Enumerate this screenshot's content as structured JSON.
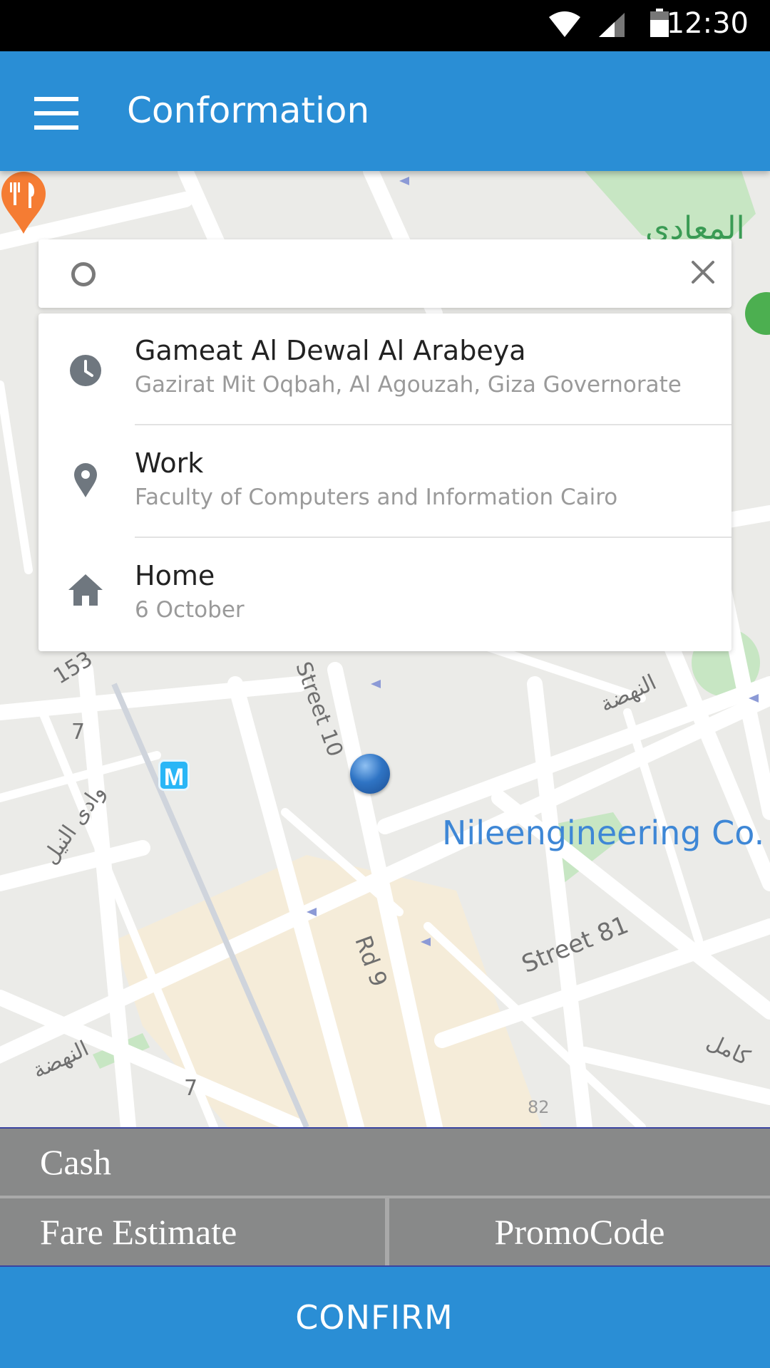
{
  "status_bar": {
    "time": "12:30",
    "icons": [
      "wifi-icon",
      "signal-icon",
      "battery-icon"
    ]
  },
  "app_bar": {
    "title": "Conformation",
    "menu_icon": "menu-icon"
  },
  "search": {
    "value": "",
    "placeholder": "",
    "origin_icon": "circle-outline-icon",
    "clear_icon": "close-icon"
  },
  "suggestions": [
    {
      "icon": "clock-icon",
      "title": "Gameat Al Dewal Al Arabeya",
      "subtitle": "Gazirat Mit Oqbah, Al Agouzah, Giza Governorate"
    },
    {
      "icon": "location-pin-icon",
      "title": "Work",
      "subtitle": "Faculty of Computers and Information Cairo"
    },
    {
      "icon": "home-icon",
      "title": "Home",
      "subtitle": "6 October"
    }
  ],
  "map": {
    "company_label": "Nileengineering Co.",
    "arabic_area": "المعادى",
    "metro_letter": "M",
    "street_labels": [
      "Street 81",
      "Rd 9",
      "Street 10",
      "153",
      "النهضة",
      "وادى النيل",
      "النهضة",
      "كامل",
      "7",
      "7",
      "82"
    ]
  },
  "payment": {
    "method": "Cash",
    "fare_label": "Fare Estimate",
    "promo_label": "PromoCode"
  },
  "confirm": {
    "label": "CONFIRM"
  },
  "colors": {
    "primary": "#2a8ed5",
    "bottom_gray": "#888989",
    "status_bar": "#000000"
  }
}
